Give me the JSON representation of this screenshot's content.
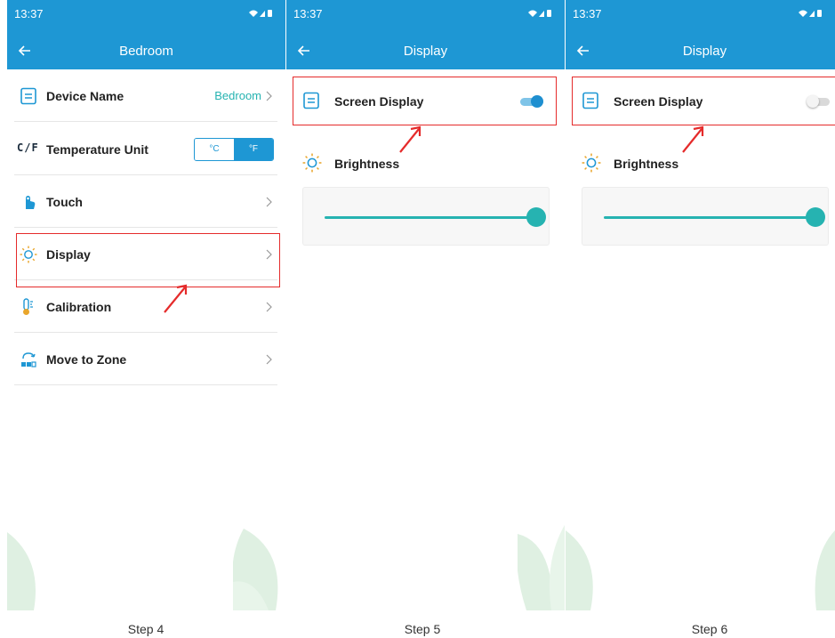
{
  "colors": {
    "primary": "#1e97d4",
    "teal": "#26b3b1",
    "highlight": "#e52b2b",
    "leaf": "#dff0e2"
  },
  "screens": [
    {
      "status_time": "13:37",
      "title": "Bedroom",
      "rows": [
        {
          "label": "Device Name",
          "value": "Bedroom",
          "icon": "document-icon"
        },
        {
          "label": "Temperature Unit",
          "icon_text": "C/F",
          "options": [
            "°C",
            "°F"
          ],
          "selected": "°F"
        },
        {
          "label": "Touch",
          "icon": "touch-hand-icon"
        },
        {
          "label": "Display",
          "icon": "sun-icon"
        },
        {
          "label": "Calibration",
          "icon": "thermometer-icon"
        },
        {
          "label": "Move to Zone",
          "icon": "move-zone-icon"
        }
      ],
      "step": "Step 4"
    },
    {
      "status_time": "13:37",
      "title": "Display",
      "screen_display": {
        "label": "Screen Display",
        "on": true
      },
      "brightness": {
        "label": "Brightness",
        "level_percent": 100
      },
      "step": "Step 5"
    },
    {
      "status_time": "13:37",
      "title": "Display",
      "screen_display": {
        "label": "Screen Display",
        "on": false
      },
      "brightness": {
        "label": "Brightness",
        "level_percent": 100
      },
      "step": "Step 6"
    }
  ]
}
